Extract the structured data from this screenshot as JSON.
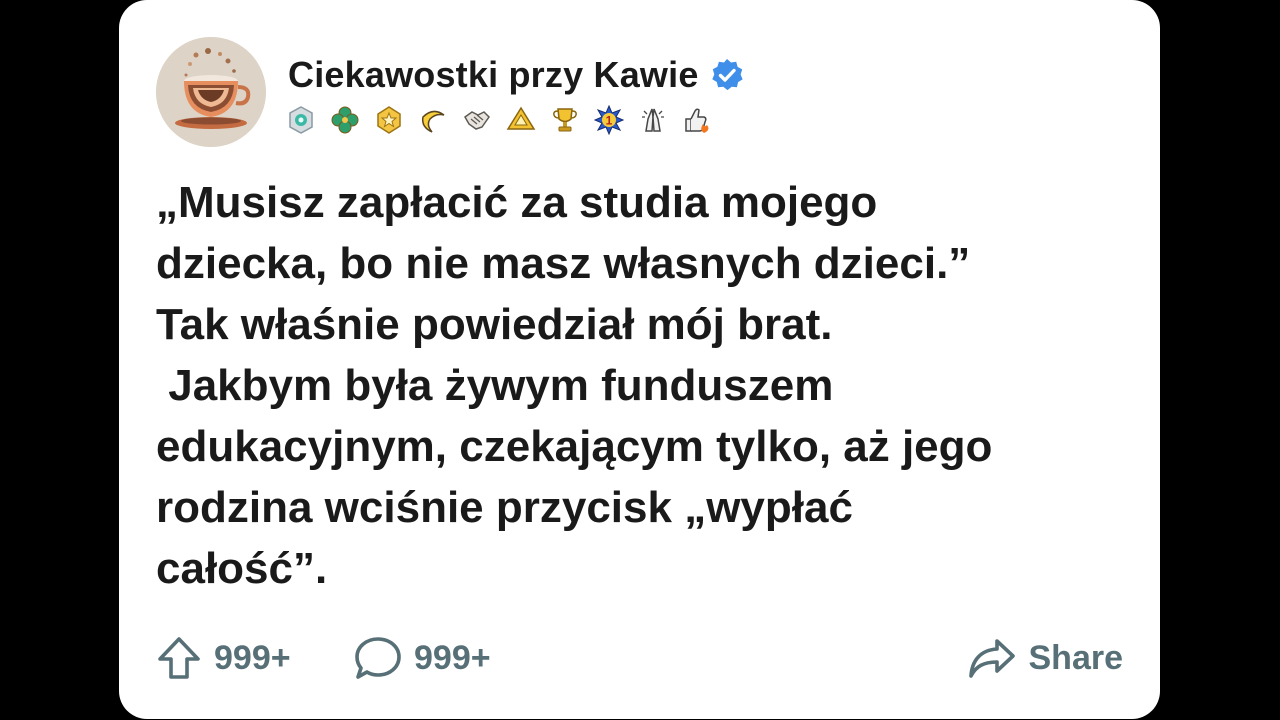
{
  "post": {
    "author": "Ciekawostki przy Kawie",
    "verified": true,
    "badge_icons": [
      "diamond-badge-icon",
      "clover-badge-icon",
      "star-badge-icon",
      "banana-badge-icon",
      "handshake-badge-icon",
      "pyramid-badge-icon",
      "trophy-badge-icon",
      "number-one-badge-icon",
      "praying-hands-badge-icon",
      "thumbs-up-fire-badge-icon"
    ],
    "text_lines": [
      "„Musisz zapłacić za studia mojego",
      "dziecka, bo nie masz własnych dzieci.”",
      "Tak właśnie powiedział mój brat.",
      " Jakbym była żywym funduszem",
      "edukacyjnym, czekającym tylko, aż jego",
      "rodzina wciśnie przycisk „wypłać",
      "całość”."
    ]
  },
  "actions": {
    "upvotes": "999+",
    "comments": "999+",
    "share_label": "Share"
  },
  "colors": {
    "background": "#000000",
    "card": "#ffffff",
    "text": "#1a1a1b",
    "action_text": "#576f76",
    "verified_blue": "#3f8ee9"
  }
}
